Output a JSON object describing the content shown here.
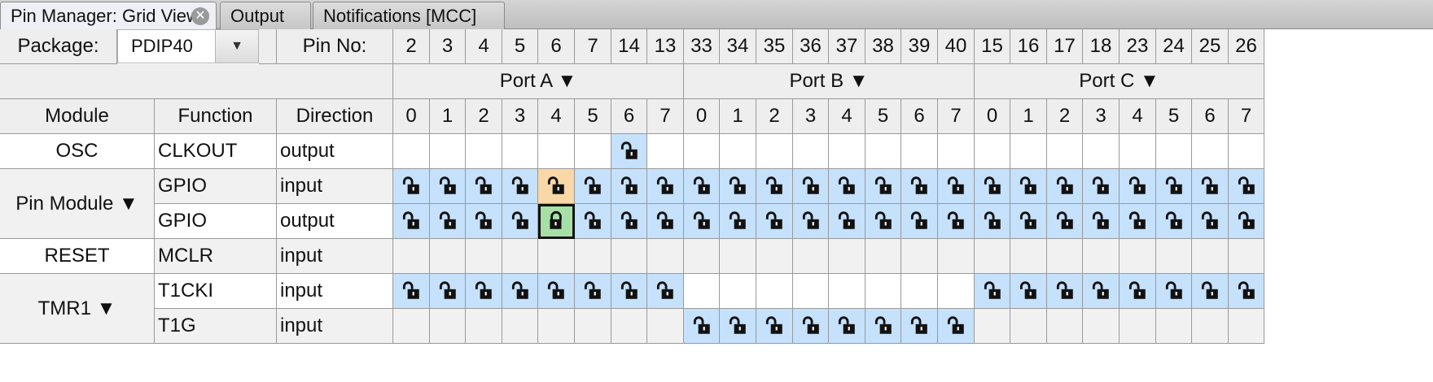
{
  "tabs": [
    {
      "label": "Pin Manager: Grid View",
      "active": true,
      "close_icon": "close-icon"
    },
    {
      "label": "Output",
      "active": false
    },
    {
      "label": "Notifications [MCC]",
      "active": false
    }
  ],
  "package": {
    "label": "Package:",
    "value": "PDIP40"
  },
  "pin_no_label": "Pin No:",
  "pin_numbers": [
    "2",
    "3",
    "4",
    "5",
    "6",
    "7",
    "14",
    "13",
    "33",
    "34",
    "35",
    "36",
    "37",
    "38",
    "39",
    "40",
    "15",
    "16",
    "17",
    "18",
    "23",
    "24",
    "25",
    "26"
  ],
  "ports": [
    {
      "label": "Port A ▼"
    },
    {
      "label": "Port B ▼"
    },
    {
      "label": "Port C ▼"
    }
  ],
  "column_headers": {
    "module": "Module",
    "function": "Function",
    "direction": "Direction"
  },
  "bit_labels": [
    "0",
    "1",
    "2",
    "3",
    "4",
    "5",
    "6",
    "7",
    "0",
    "1",
    "2",
    "3",
    "4",
    "5",
    "6",
    "7",
    "0",
    "1",
    "2",
    "3",
    "4",
    "5",
    "6",
    "7"
  ],
  "modules": [
    {
      "label": "OSC",
      "rows": 1
    },
    {
      "label": "Pin Module ▼",
      "rows": 2
    },
    {
      "label": "RESET",
      "rows": 1
    },
    {
      "label": "TMR1 ▼",
      "rows": 2
    }
  ],
  "rows": [
    {
      "function": "CLKOUT",
      "direction": "output",
      "cells": "------U-----------------",
      "bg": "w"
    },
    {
      "function": "GPIO",
      "direction": "input",
      "cells": "UUUUOUUUUUUUUUUUUUUUUUUU",
      "bg": "g"
    },
    {
      "function": "GPIO",
      "direction": "output",
      "cells": "UUUULUUUUUUUUUUUUUUUUUUU",
      "bg": "w"
    },
    {
      "function": "MCLR",
      "direction": "input",
      "cells": "------------------------",
      "bg": "g"
    },
    {
      "function": "T1CKI",
      "direction": "input",
      "cells": "UUUUUUUU--------UUUUUUUU",
      "bg": "w"
    },
    {
      "function": "T1G",
      "direction": "input",
      "cells": "--------UUUUUUUU--------",
      "bg": "g"
    }
  ],
  "cell_legend": {
    "U": {
      "state": "unlocked",
      "icon": "unlock-icon",
      "color": "#c5e1fb"
    },
    "O": {
      "state": "unlocked-highlight",
      "icon": "unlock-icon",
      "color": "#f9d7a6"
    },
    "L": {
      "state": "locked-selected",
      "icon": "lock-icon",
      "color": "#a6e0a6"
    },
    "-": {
      "state": "unavailable"
    }
  },
  "colors": {
    "grid_line": "#9a9a9a",
    "header_bg": "#eeeeee",
    "unlock_bg": "#c5e1fb"
  }
}
